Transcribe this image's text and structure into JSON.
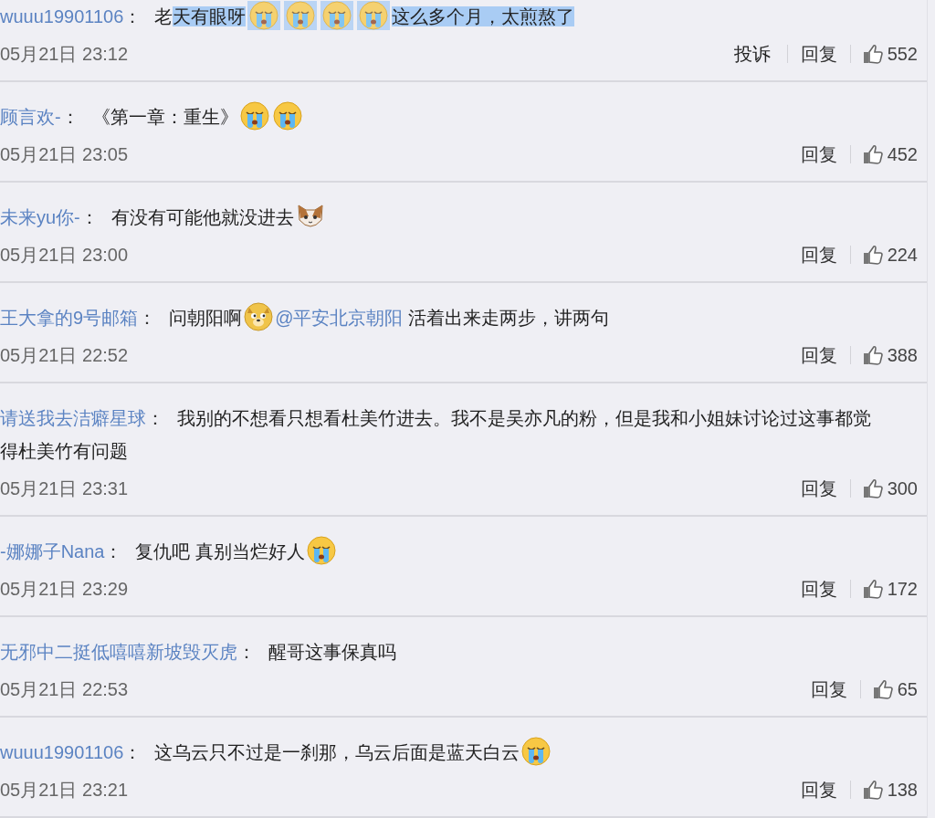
{
  "comments": [
    {
      "user": "wuuu19901106",
      "colon": "：",
      "segments": [
        {
          "kind": "text",
          "text": "老",
          "selected": false
        },
        {
          "kind": "text",
          "text": "天有眼呀",
          "selected": true
        },
        {
          "kind": "cry",
          "selected": true
        },
        {
          "kind": "cry",
          "selected": true
        },
        {
          "kind": "cry",
          "selected": true
        },
        {
          "kind": "cry",
          "selected": true
        },
        {
          "kind": "text",
          "text": "这么多个月，太煎熬了",
          "selected": true
        }
      ],
      "time": "05月21日 23:12",
      "actions": [
        {
          "kind": "report",
          "label": "投诉"
        },
        {
          "kind": "reply",
          "label": "回复"
        }
      ],
      "likes": "552"
    },
    {
      "user": "顾言欢-",
      "colon": "：",
      "segments": [
        {
          "kind": "text",
          "text": "《第一章：重生》"
        },
        {
          "kind": "cry"
        },
        {
          "kind": "cry"
        }
      ],
      "time": "05月21日 23:05",
      "actions": [
        {
          "kind": "reply",
          "label": "回复"
        }
      ],
      "likes": "452"
    },
    {
      "user": "未来yu你-",
      "colon": "：",
      "segments": [
        {
          "kind": "text",
          "text": "有没有可能他就没进去"
        },
        {
          "kind": "cat"
        }
      ],
      "time": "05月21日 23:00",
      "actions": [
        {
          "kind": "reply",
          "label": "回复"
        }
      ],
      "likes": "224"
    },
    {
      "user": "王大拿的9号邮箱",
      "colon": "：",
      "segments": [
        {
          "kind": "text",
          "text": "问朝阳啊"
        },
        {
          "kind": "doge"
        },
        {
          "kind": "mention",
          "text": "@平安北京朝阳"
        },
        {
          "kind": "text",
          "text": "活着出来走两步，讲两句"
        }
      ],
      "time": "05月21日 22:52",
      "actions": [
        {
          "kind": "reply",
          "label": "回复"
        }
      ],
      "likes": "388"
    },
    {
      "user": "请送我去洁癖星球",
      "colon": "：",
      "segments": [
        {
          "kind": "text",
          "text": "我别的不想看只想看杜美竹进去。我不是吴亦凡的粉，但是我和小姐妹讨论过这事都觉"
        },
        {
          "kind": "line",
          "text": "得杜美竹有问题"
        }
      ],
      "time": "05月21日 23:31",
      "actions": [
        {
          "kind": "reply",
          "label": "回复"
        }
      ],
      "likes": "300"
    },
    {
      "user": "-娜娜子Nana",
      "colon": "：",
      "segments": [
        {
          "kind": "text",
          "text": "复仇吧 真别当烂好人"
        },
        {
          "kind": "cry"
        }
      ],
      "time": "05月21日 23:29",
      "actions": [
        {
          "kind": "reply",
          "label": "回复"
        }
      ],
      "likes": "172"
    },
    {
      "user": "无邪中二挺低嘻嘻新坡毁灭虎",
      "colon": "：",
      "segments": [
        {
          "kind": "text",
          "text": "醒哥这事保真吗"
        }
      ],
      "time": "05月21日 22:53",
      "actions": [
        {
          "kind": "reply",
          "label": "回复"
        }
      ],
      "likes": "65"
    },
    {
      "user": "wuuu19901106",
      "colon": "：",
      "segments": [
        {
          "kind": "text",
          "text": "这乌云只不过是一刹那，乌云后面是蓝天白云"
        },
        {
          "kind": "cry"
        }
      ],
      "time": "05月21日 23:21",
      "actions": [
        {
          "kind": "reply",
          "label": "回复"
        }
      ],
      "likes": "138"
    }
  ]
}
